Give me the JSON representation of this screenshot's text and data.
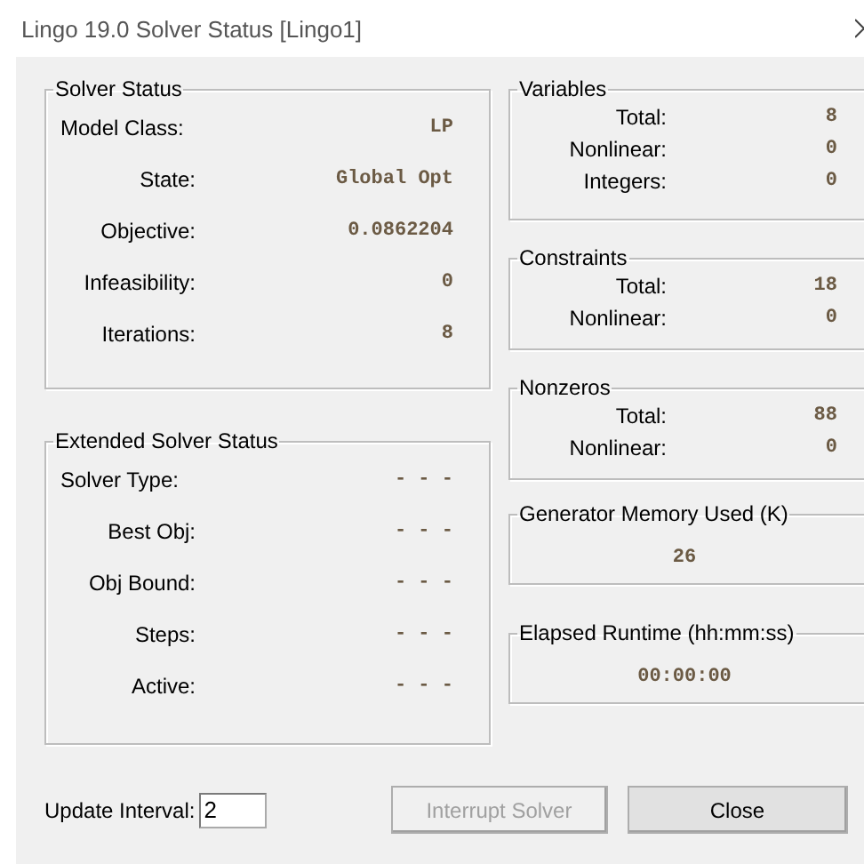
{
  "window": {
    "title": "Lingo 19.0 Solver Status [Lingo1]"
  },
  "solver_status": {
    "title": "Solver Status",
    "rows": [
      {
        "label": "Model Class:",
        "value": "LP"
      },
      {
        "label": "State:",
        "value": "Global Opt"
      },
      {
        "label": "Objective:",
        "value": "0.0862204"
      },
      {
        "label": "Infeasibility:",
        "value": "0"
      },
      {
        "label": "Iterations:",
        "value": "8"
      }
    ]
  },
  "extended_solver_status": {
    "title": "Extended Solver Status",
    "rows": [
      {
        "label": "Solver Type:",
        "value": "- - -"
      },
      {
        "label": "Best Obj:",
        "value": "- - -"
      },
      {
        "label": "Obj Bound:",
        "value": "- - -"
      },
      {
        "label": "Steps:",
        "value": "- - -"
      },
      {
        "label": "Active:",
        "value": "- - -"
      }
    ]
  },
  "right_groups": [
    {
      "kind": "table",
      "title": "Variables",
      "rows": [
        {
          "label": "Total:",
          "value": "8"
        },
        {
          "label": "Nonlinear:",
          "value": "0"
        },
        {
          "label": "Integers:",
          "value": "0"
        }
      ]
    },
    {
      "kind": "table",
      "title": "Constraints",
      "rows": [
        {
          "label": "Total:",
          "value": "18"
        },
        {
          "label": "Nonlinear:",
          "value": "0"
        }
      ]
    },
    {
      "kind": "table",
      "title": "Nonzeros",
      "rows": [
        {
          "label": "Total:",
          "value": "88"
        },
        {
          "label": "Nonlinear:",
          "value": "0"
        }
      ]
    },
    {
      "kind": "single",
      "title": "Generator Memory Used (K)",
      "value": "26"
    },
    {
      "kind": "single",
      "title": "Elapsed Runtime (hh:mm:ss)",
      "value": "00:00:00"
    }
  ],
  "update_interval": {
    "label": "Update Interval:",
    "value": "2"
  },
  "buttons": [
    {
      "label": "Interrupt Solver",
      "disabled": true
    },
    {
      "label": "Close",
      "disabled": false
    }
  ]
}
